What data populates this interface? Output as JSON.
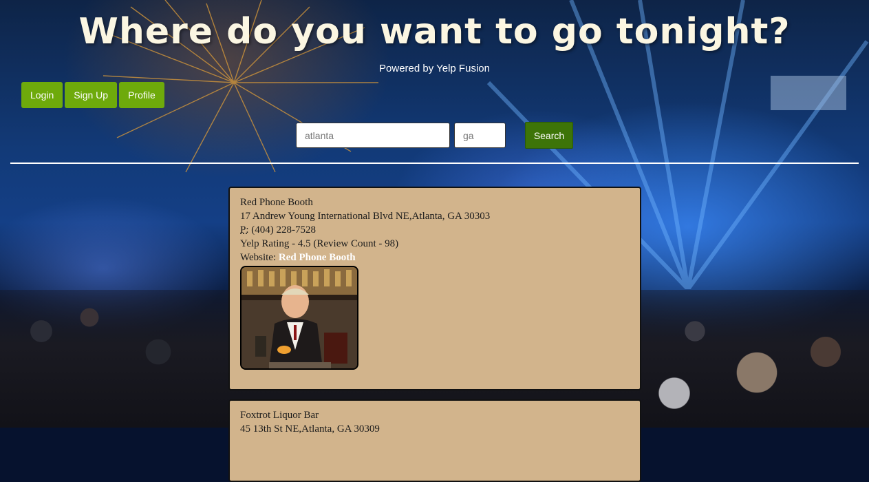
{
  "header": {
    "title": "Where do you want to go tonight?",
    "subtitle": "Powered by Yelp Fusion"
  },
  "auth": {
    "login_label": "Login",
    "signup_label": "Sign Up",
    "profile_label": "Profile"
  },
  "search": {
    "city_value": "atlanta",
    "state_value": "ga",
    "button_label": "Search"
  },
  "results": [
    {
      "name": "Red Phone Booth",
      "address": "17 Andrew Young International Blvd NE,Atlanta, GA 30303",
      "phone_prefix": "P:",
      "phone": "(404) 228-7528",
      "rating": "Yelp Rating - 4.5 (Review Count - 98)",
      "website_label": "Website:",
      "website_link": "Red Phone Booth"
    },
    {
      "name": "Foxtrot Liquor Bar",
      "address": "45 13th St NE,Atlanta, GA 30309"
    }
  ],
  "colors": {
    "button_green": "#6eaa0b",
    "search_green": "#3d7408",
    "card_tan": "#d2b48c",
    "title_cream": "#fbf6e2"
  }
}
